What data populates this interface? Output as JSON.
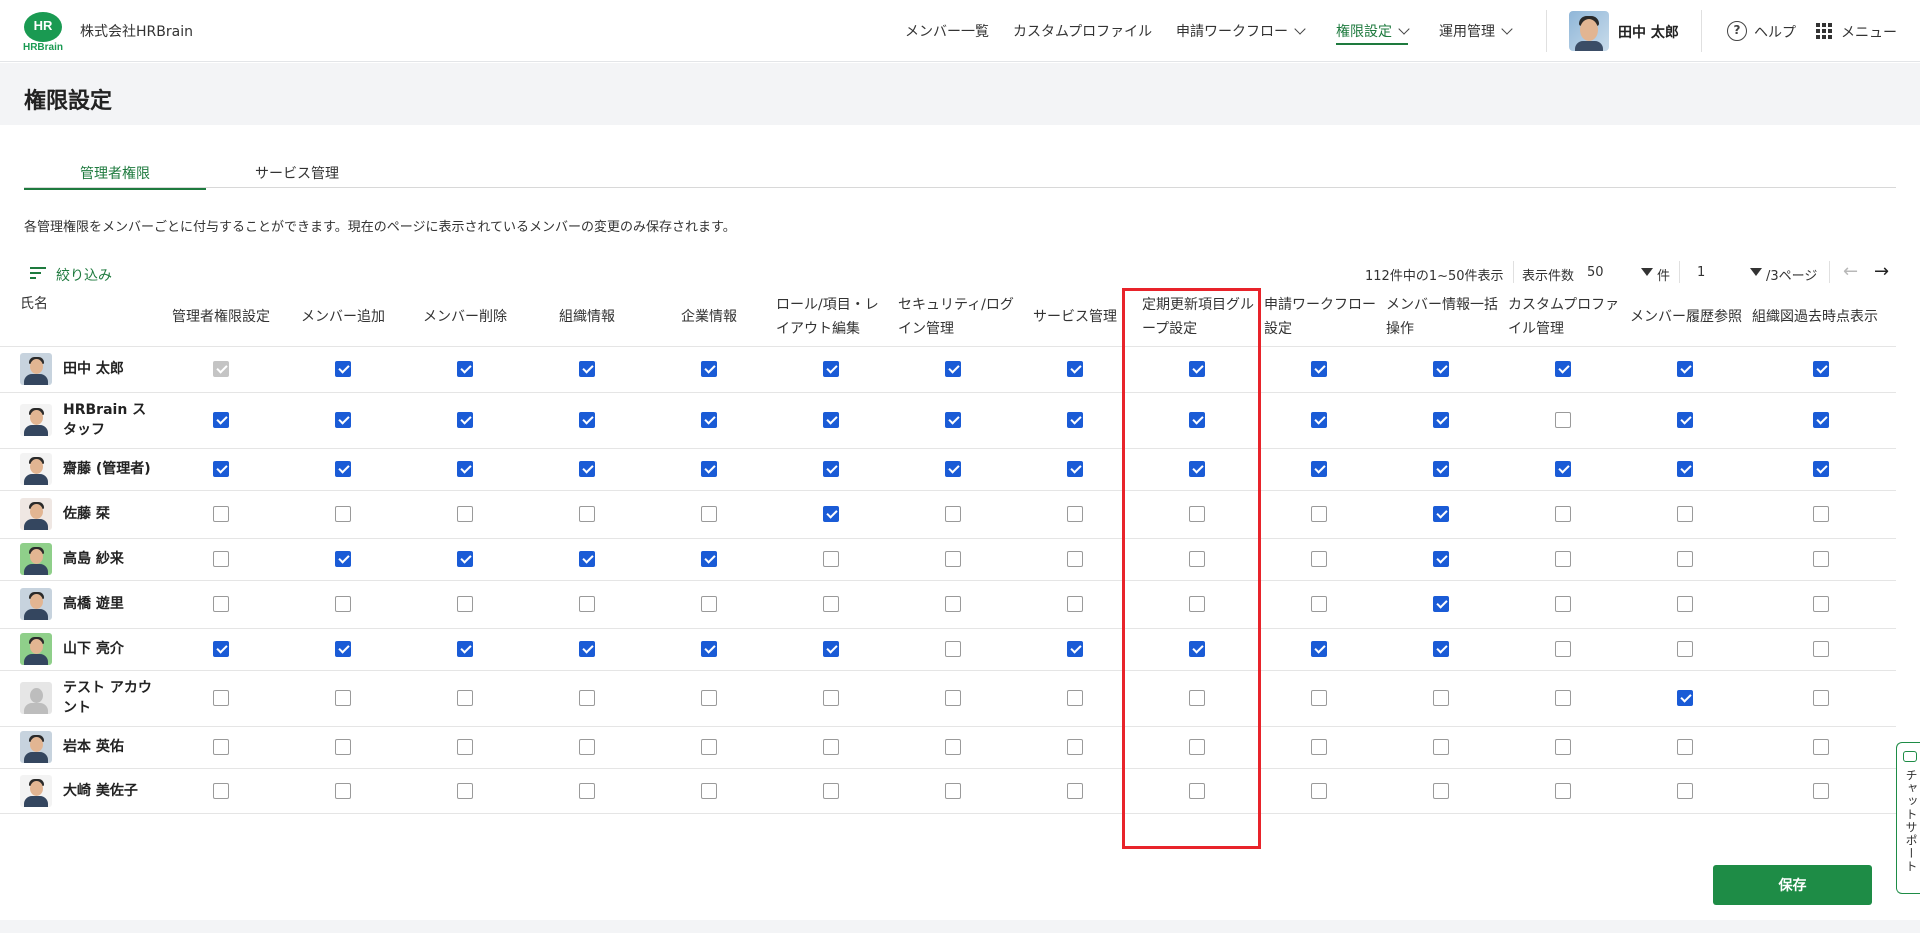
{
  "header": {
    "logo_top": "HR",
    "logo_bottom": "HRBrain",
    "company": "株式会社HRBrain",
    "nav": [
      {
        "label": "メンバー一覧"
      },
      {
        "label": "カスタムプロファイル"
      },
      {
        "label": "申請ワークフロー"
      },
      {
        "label": "権限設定"
      },
      {
        "label": "運用管理"
      }
    ],
    "user_name": "田中 太郎",
    "help": "ヘルプ",
    "menu": "メニュー"
  },
  "page": {
    "title": "権限設定",
    "tabs": [
      "管理者権限",
      "サービス管理"
    ],
    "description": "各管理権限をメンバーごとに付与することができます。現在のページに表示されているメンバーの変更のみ保存されます。",
    "filter": "絞り込み",
    "range_text": "112件中の1~50件表示",
    "per_page_label": "表示件数",
    "per_page_value": "50",
    "per_page_unit": "件",
    "page_value": "1",
    "page_total": "/3ページ",
    "save": "保存",
    "chat_support": "チャットサポート"
  },
  "table": {
    "name_header": "氏名",
    "columns": [
      "管理者権限設定",
      "メンバー追加",
      "メンバー削除",
      "組織情報",
      "企業情報",
      "ロール/項目・レイアウト編集",
      "セキュリティ/ログイン管理",
      "サービス管理",
      "定期更新項目グループ設定",
      "申請ワークフロー設定",
      "メンバー情報一括操作",
      "カスタムプロファイル管理",
      "メンバー履歴参照",
      "組織図過去時点表示"
    ],
    "rows": [
      {
        "name": "田中 太郎",
        "avatar": "photo",
        "checks": [
          2,
          1,
          1,
          1,
          1,
          1,
          1,
          1,
          1,
          1,
          1,
          1,
          1,
          1
        ]
      },
      {
        "name": "HRBrain スタッフ",
        "avatar": "photo-white",
        "checks": [
          1,
          1,
          1,
          1,
          1,
          1,
          1,
          1,
          1,
          1,
          1,
          0,
          1,
          1
        ]
      },
      {
        "name": "齋藤 (管理者)",
        "avatar": "photo-white",
        "checks": [
          1,
          1,
          1,
          1,
          1,
          1,
          1,
          1,
          1,
          1,
          1,
          1,
          1,
          1
        ]
      },
      {
        "name": "佐藤 栞",
        "avatar": "photo-light",
        "checks": [
          0,
          0,
          0,
          0,
          0,
          1,
          0,
          0,
          0,
          0,
          1,
          0,
          0,
          0
        ]
      },
      {
        "name": "高島 紗来",
        "avatar": "photo-green",
        "checks": [
          0,
          1,
          1,
          1,
          1,
          0,
          0,
          0,
          0,
          0,
          1,
          0,
          0,
          0
        ]
      },
      {
        "name": "高橋 遊里",
        "avatar": "photo",
        "checks": [
          0,
          0,
          0,
          0,
          0,
          0,
          0,
          0,
          0,
          0,
          1,
          0,
          0,
          0
        ]
      },
      {
        "name": "山下 亮介",
        "avatar": "photo-green",
        "checks": [
          1,
          1,
          1,
          1,
          1,
          1,
          0,
          1,
          1,
          1,
          1,
          0,
          0,
          0
        ]
      },
      {
        "name": "テスト アカウント",
        "avatar": "default",
        "checks": [
          0,
          0,
          0,
          0,
          0,
          0,
          0,
          0,
          0,
          0,
          0,
          0,
          1,
          0
        ]
      },
      {
        "name": "岩本 英佑",
        "avatar": "photo",
        "checks": [
          0,
          0,
          0,
          0,
          0,
          0,
          0,
          0,
          0,
          0,
          0,
          0,
          0,
          0
        ]
      },
      {
        "name": "大崎 美佐子",
        "avatar": "photo-white",
        "checks": [
          0,
          0,
          0,
          0,
          0,
          0,
          0,
          0,
          0,
          0,
          0,
          0,
          0,
          0
        ]
      }
    ]
  },
  "colors": {
    "accent_green": "#1e7a3e",
    "checkbox_blue": "#1a5bd6",
    "highlight_red": "#e8232a"
  }
}
